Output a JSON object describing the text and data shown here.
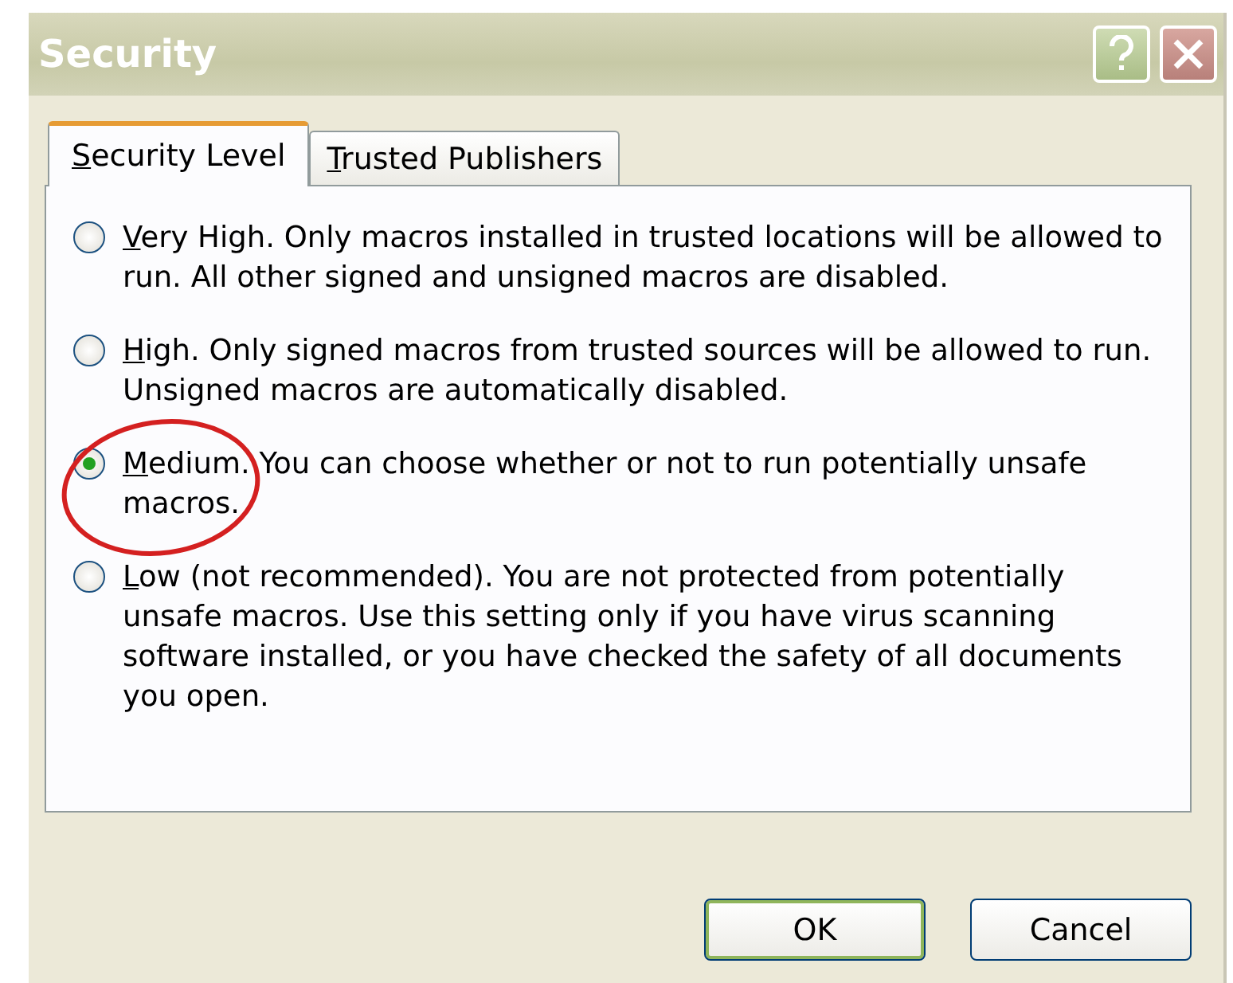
{
  "window": {
    "title": "Security"
  },
  "tabs": [
    {
      "label": "Security Level",
      "selected": true
    },
    {
      "label": "Trusted Publishers",
      "selected": false
    }
  ],
  "options": [
    {
      "label": "Very High. Only macros installed in trusted locations will be allowed to run. All other signed and unsigned macros are disabled.",
      "selected": false
    },
    {
      "label": "High. Only signed macros from trusted sources will be allowed to run. Unsigned macros are automatically disabled.",
      "selected": false
    },
    {
      "label": "Medium. You can choose whether or not to run potentially unsafe macros.",
      "selected": true
    },
    {
      "label": "Low (not recommended). You are not protected from potentially unsafe macros. Use this setting only if you have virus scanning software installed, or you have checked the safety of all documents you open.",
      "selected": false
    }
  ],
  "buttons": [
    "OK",
    "Cancel"
  ]
}
